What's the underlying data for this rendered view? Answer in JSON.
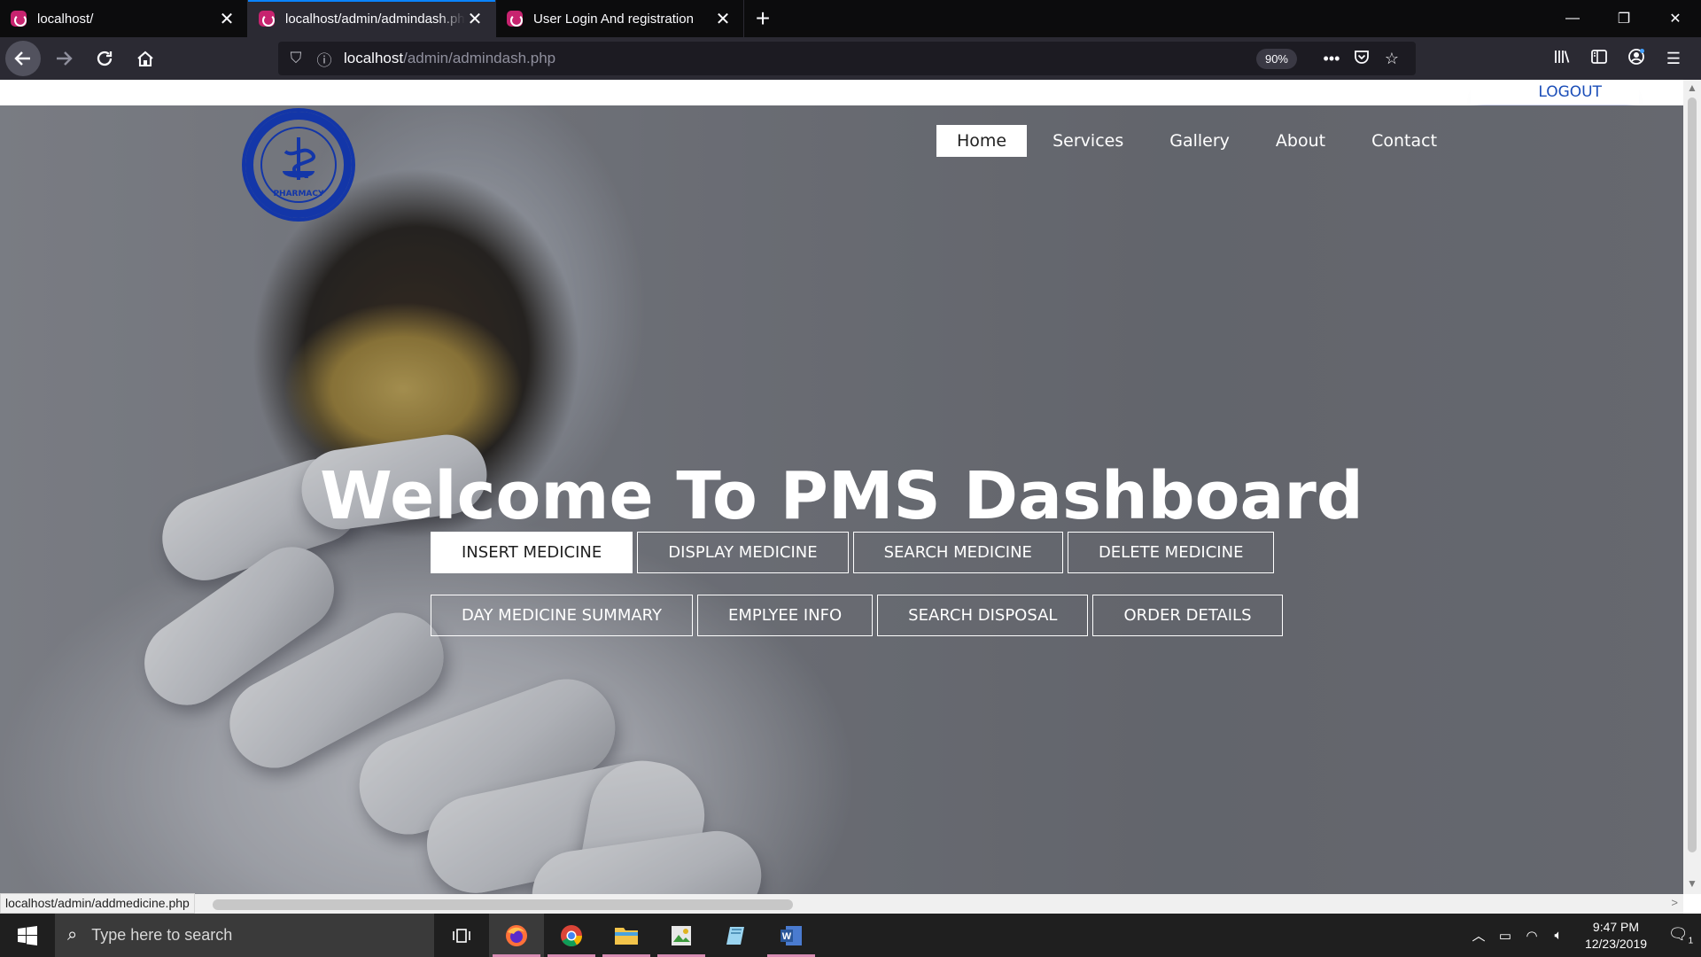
{
  "browser": {
    "tabs": [
      {
        "title": "localhost/",
        "active": false
      },
      {
        "title": "localhost/admin/admindash.php",
        "active": true
      },
      {
        "title": "User Login And registration",
        "active": false
      }
    ],
    "url_host": "localhost",
    "url_path": "/admin/admindash.php",
    "zoom": "90%",
    "status_url": "localhost/admin/addmedicine.php"
  },
  "page": {
    "logout": "LOGOUT",
    "logo_text": "PHARMACY",
    "nav": [
      "Home",
      "Services",
      "Gallery",
      "About",
      "Contact"
    ],
    "headline": "Welcome To PMS Dashboard",
    "buttons_row1": [
      "INSERT MEDICINE",
      "DISPLAY MEDICINE",
      "SEARCH MEDICINE",
      "DELETE MEDICINE"
    ],
    "buttons_row2": [
      "DAY MEDICINE SUMMARY",
      "EMPLYEE INFO",
      "SEARCH DISPOSAL",
      "ORDER DETAILS"
    ]
  },
  "taskbar": {
    "search_placeholder": "Type here to search",
    "time": "9:47 PM",
    "date": "12/23/2019",
    "notification_count": "1"
  }
}
